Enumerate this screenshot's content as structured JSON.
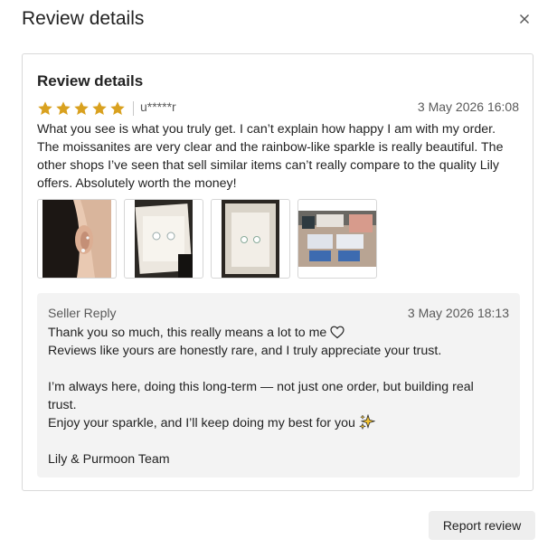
{
  "modal": {
    "title": "Review details"
  },
  "review": {
    "heading": "Review details",
    "rating": 5,
    "rating_max": 5,
    "reviewer": "u*****r",
    "date": "3 May 2026 16:08",
    "text": "What you see is what you truly get. I can’t explain how happy I am with my order. The moissanites are very clear and the rainbow-like sparkle is really beautiful. The other shops I’ve seen that sell similar items can’t really compare to the quality Lily offers. Absolutely worth the money!",
    "star_color": "#d9a11f",
    "photos": [
      "photo-ear",
      "photo-earrings-box",
      "photo-earrings-closeup",
      "photo-packaging"
    ]
  },
  "seller_reply": {
    "label": "Seller Reply",
    "date": "3 May 2026 18:13",
    "lines": [
      "Thank you so much, this really means a lot to me",
      "Reviews like yours are honestly rare, and I truly appreciate your trust.",
      "",
      "I’m always here, doing this long-term — not just one order, but building real trust.",
      "Enjoy your sparkle, and I’ll keep doing my best for you",
      "",
      "Lily & Purmoon Team"
    ],
    "icons": [
      "heart-icon",
      "sparkles-icon"
    ]
  },
  "actions": {
    "report_label": "Report review"
  }
}
